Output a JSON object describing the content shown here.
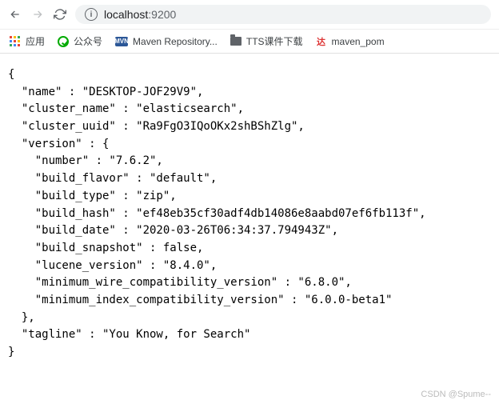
{
  "browser": {
    "url_display_host": "localhost",
    "url_display_port": ":9200"
  },
  "bookmarks": {
    "apps_label": "应用",
    "item1_label": "公众号",
    "item2_icon_text": "MVN",
    "item2_label": "Maven Repository...",
    "item3_label": "TTS课件下载",
    "item4_icon_text": "达",
    "item4_label": "maven_pom"
  },
  "response": {
    "name": "DESKTOP-JOF29V9",
    "cluster_name": "elasticsearch",
    "cluster_uuid": "Ra9FgO3IQoOKx2shBShZlg",
    "version": {
      "number": "7.6.2",
      "build_flavor": "default",
      "build_type": "zip",
      "build_hash": "ef48eb35cf30adf4db14086e8aabd07ef6fb113f",
      "build_date": "2020-03-26T06:34:37.794943Z",
      "build_snapshot": false,
      "lucene_version": "8.4.0",
      "minimum_wire_compatibility_version": "6.8.0",
      "minimum_index_compatibility_version": "6.0.0-beta1"
    },
    "tagline": "You Know, for Search"
  },
  "json_lines": {
    "l0": "{",
    "l1": "  \"name\" : \"DESKTOP-JOF29V9\",",
    "l2": "  \"cluster_name\" : \"elasticsearch\",",
    "l3": "  \"cluster_uuid\" : \"Ra9FgO3IQoOKx2shBShZlg\",",
    "l4": "  \"version\" : {",
    "l5": "    \"number\" : \"7.6.2\",",
    "l6": "    \"build_flavor\" : \"default\",",
    "l7": "    \"build_type\" : \"zip\",",
    "l8": "    \"build_hash\" : \"ef48eb35cf30adf4db14086e8aabd07ef6fb113f\",",
    "l9": "    \"build_date\" : \"2020-03-26T06:34:37.794943Z\",",
    "l10": "    \"build_snapshot\" : false,",
    "l11": "    \"lucene_version\" : \"8.4.0\",",
    "l12": "    \"minimum_wire_compatibility_version\" : \"6.8.0\",",
    "l13": "    \"minimum_index_compatibility_version\" : \"6.0.0-beta1\"",
    "l14": "  },",
    "l15": "  \"tagline\" : \"You Know, for Search\"",
    "l16": "}"
  },
  "watermark": "CSDN @Spume--"
}
